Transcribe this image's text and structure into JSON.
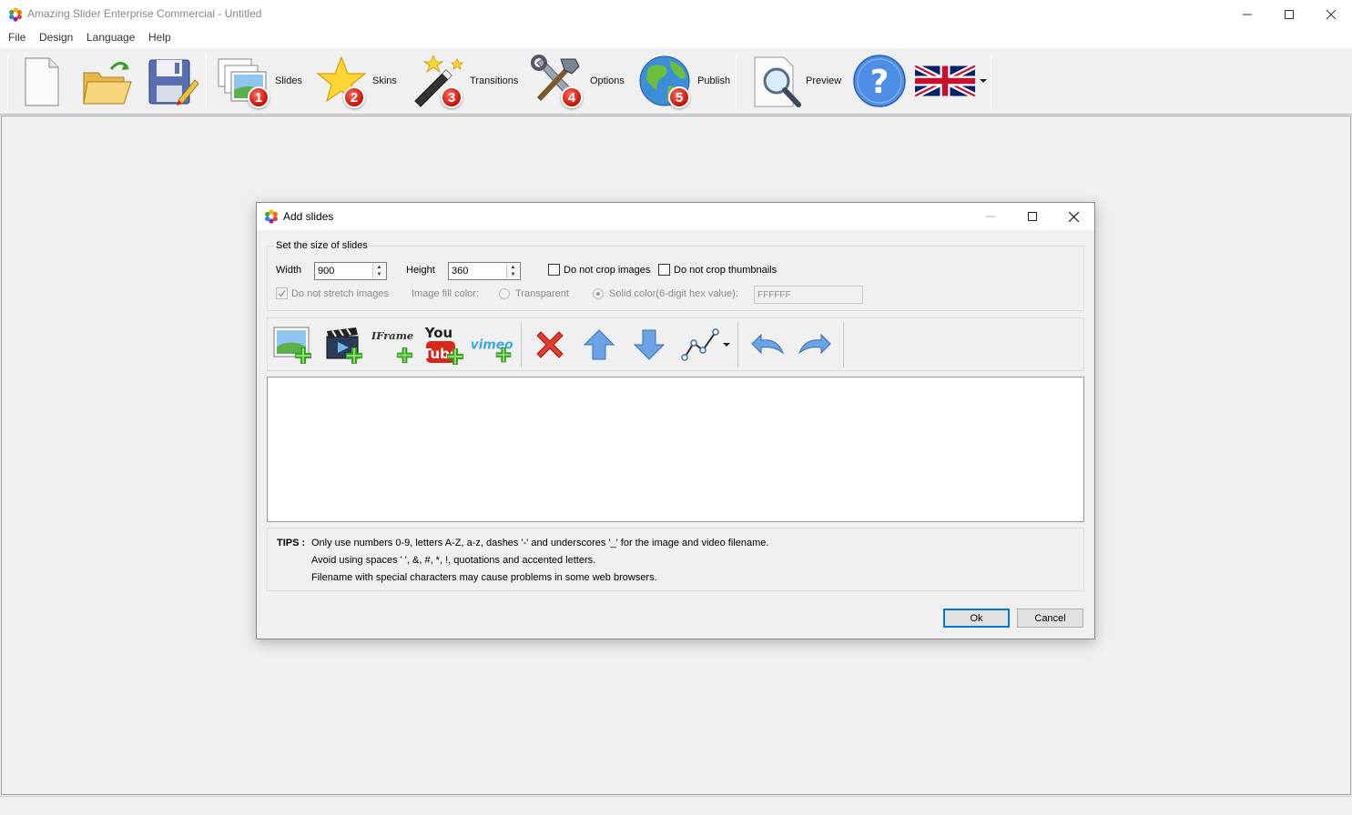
{
  "window": {
    "title": "Amazing Slider Enterprise Commercial - Untitled"
  },
  "menu": [
    "File",
    "Design",
    "Language",
    "Help"
  ],
  "toolbar": {
    "buttons": [
      {
        "label": "",
        "icon": "new-file-icon"
      },
      {
        "label": "",
        "icon": "open-folder-icon"
      },
      {
        "label": "",
        "icon": "save-icon"
      },
      {
        "label": "Slides",
        "icon": "slides-icon",
        "step": "1"
      },
      {
        "label": "Skins",
        "icon": "star-icon",
        "step": "2"
      },
      {
        "label": "Transitions",
        "icon": "magic-wand-icon",
        "step": "3"
      },
      {
        "label": "Options",
        "icon": "tools-icon",
        "step": "4"
      },
      {
        "label": "Publish",
        "icon": "globe-icon",
        "step": "5"
      },
      {
        "label": "Preview",
        "icon": "magnifier-icon"
      },
      {
        "label": "",
        "icon": "help-icon"
      },
      {
        "label": "",
        "icon": "uk-flag-icon"
      }
    ]
  },
  "dialog": {
    "title": "Add slides",
    "size_group": {
      "title": "Set the size of slides",
      "width_label": "Width",
      "width_value": "900",
      "height_label": "Height",
      "height_value": "360",
      "no_crop_images": "Do not crop images",
      "no_crop_thumbnails": "Do not crop thumbnails",
      "no_stretch": "Do not stretch images",
      "fill_color_label": "Image fill color:",
      "transparent": "Transparent",
      "solid_color": "Solid color(6-digit hex value):",
      "hex_value": "FFFFFF"
    },
    "toolbar_icons": {
      "iframe_text": "IFrame",
      "youtube_you": "You",
      "youtube_tube": "Tube",
      "vimeo_text": "vimeo"
    },
    "tips": {
      "label": "TIPS :",
      "lines": [
        "Only use numbers 0-9, letters A-Z, a-z, dashes '-' and underscores '_' for the image and video filename.",
        "Avoid using spaces ' ', &, #, *, !, quotations and accented letters.",
        "Filename with special characters may cause problems in some web browsers."
      ]
    },
    "ok_label": "Ok",
    "cancel_label": "Cancel"
  },
  "colors": {
    "badge_red": "#d42a1e",
    "accent_blue": "#0078d7"
  }
}
